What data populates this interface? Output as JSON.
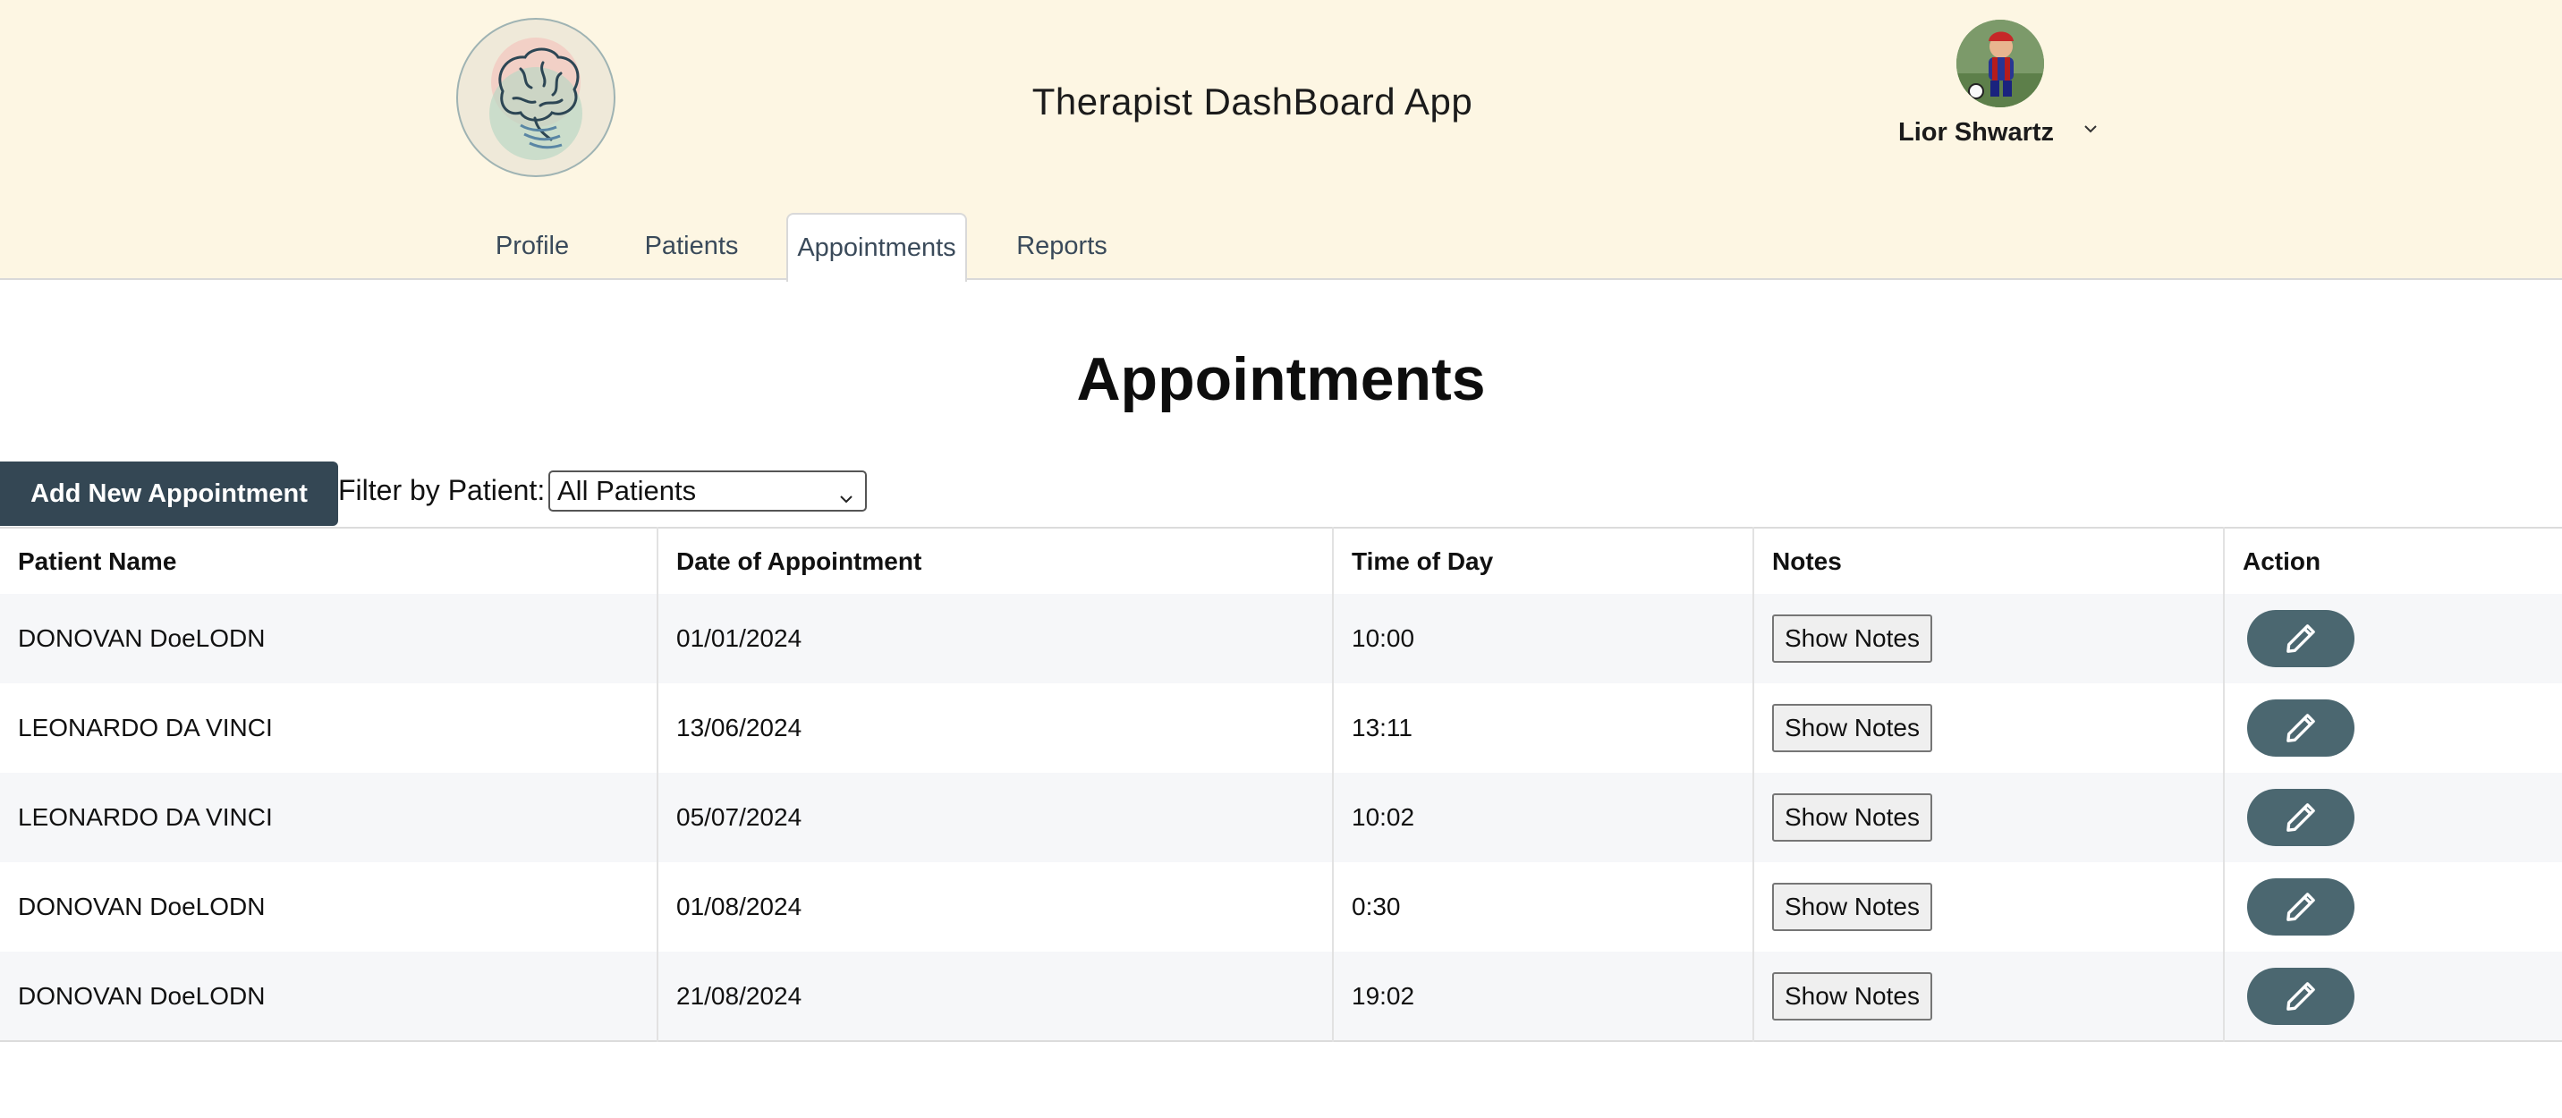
{
  "header": {
    "app_title": "Therapist DashBoard App",
    "user_name": "Lior Shwartz",
    "logo_icon": "brain-icon",
    "avatar_icon": "user-avatar",
    "background_color": "#fdf6e3"
  },
  "tabs": [
    {
      "label": "Profile",
      "active": false
    },
    {
      "label": "Patients",
      "active": false
    },
    {
      "label": "Appointments",
      "active": true
    },
    {
      "label": "Reports",
      "active": false
    }
  ],
  "main": {
    "title": "Appointments",
    "add_button_label": "Add New Appointment",
    "filter_label": "Filter by Patient:",
    "filter_value": "All Patients",
    "accent_color": "#344754"
  },
  "table": {
    "columns": [
      "Patient Name",
      "Date of Appointment",
      "Time of Day",
      "Notes",
      "Action"
    ],
    "notes_button_label": "Show Notes",
    "action_icon": "pencil-icon",
    "rows": [
      {
        "patient": "DONOVAN DoeLODN",
        "date": "01/01/2024",
        "time": "10:00"
      },
      {
        "patient": "LEONARDO DA VINCI",
        "date": "13/06/2024",
        "time": "13:11"
      },
      {
        "patient": "LEONARDO DA VINCI",
        "date": "05/07/2024",
        "time": "10:02"
      },
      {
        "patient": "DONOVAN DoeLODN",
        "date": "01/08/2024",
        "time": "0:30"
      },
      {
        "patient": "DONOVAN DoeLODN",
        "date": "21/08/2024",
        "time": "19:02"
      }
    ]
  }
}
